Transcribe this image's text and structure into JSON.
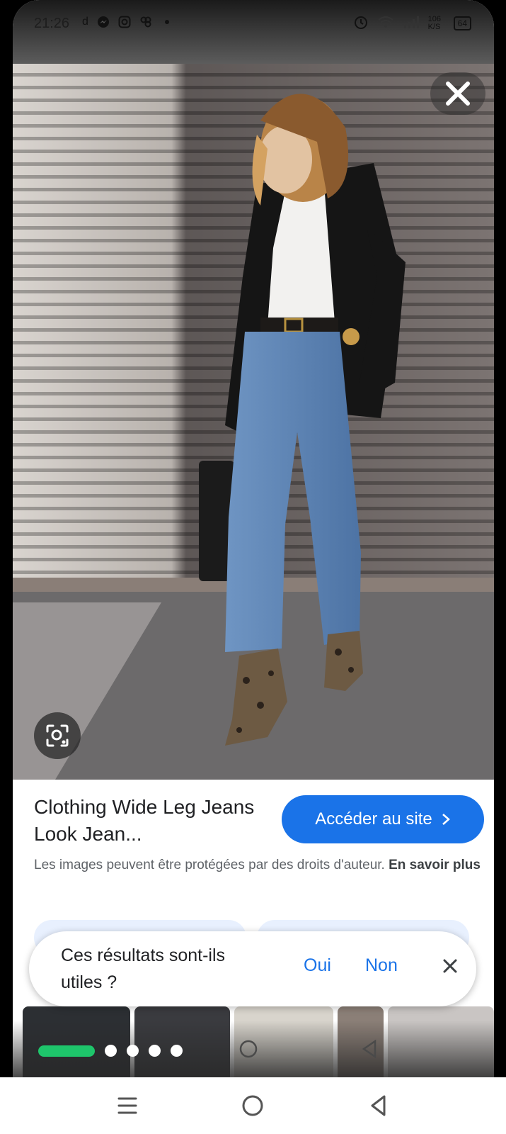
{
  "status_bar": {
    "time": "21:26",
    "left_icons": [
      "d",
      "messenger-icon",
      "instagram-icon",
      "app-icon",
      "dot-icon"
    ],
    "right_icons": [
      "alarm-icon",
      "wifi-icon",
      "signal-icon"
    ],
    "speed": "106 K/S",
    "battery": "64"
  },
  "viewer": {
    "close_icon": "close-icon",
    "lens_icon": "lens-icon"
  },
  "result": {
    "title": "Clothing Wide Leg Jeans Look Jean...",
    "visit_button": "Accéder au site",
    "copyright_text": "Les images peuvent être protégées par des droits d'auteur.",
    "learn_more": "En savoir plus"
  },
  "feedback": {
    "question": "Ces résultats sont-ils utiles ?",
    "yes": "Oui",
    "no": "Non"
  },
  "colors": {
    "accent": "#1a73e8",
    "tab_indicator": "#1ec56b",
    "text_primary": "#202124",
    "text_secondary": "#5f6368"
  }
}
